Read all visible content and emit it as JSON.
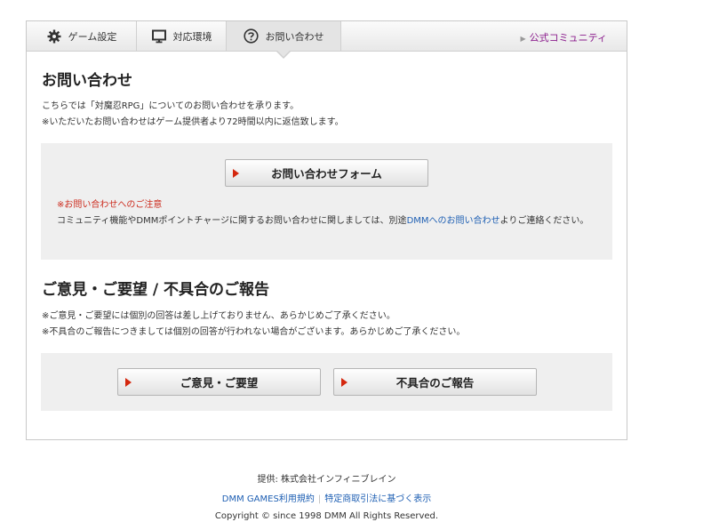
{
  "tabs": [
    {
      "label": "ゲーム設定",
      "icon": "gear-icon"
    },
    {
      "label": "対応環境",
      "icon": "monitor-icon"
    },
    {
      "label": "お問い合わせ",
      "icon": "question-circle-icon"
    }
  ],
  "community_link": "公式コミュニティ",
  "inquiry": {
    "heading": "お問い合わせ",
    "line1": "こちらでは「対魔忍RPG」についてのお問い合わせを承ります。",
    "line2": "※いただいたお問い合わせはゲーム提供者より72時間以内に返信致します。",
    "form_button": "お問い合わせフォーム",
    "notice_title": "※お問い合わせへのご注意",
    "notice_before": "コミュニティ機能やDMMポイントチャージに関するお問い合わせに関しましては、別途",
    "notice_link": "DMMへのお問い合わせ",
    "notice_after": "よりご連絡ください。"
  },
  "feedback": {
    "heading": "ご意見・ご要望 / 不具合のご報告",
    "line1": "※ご意見・ご要望には個別の回答は差し上げておりません、あらかじめご了承ください。",
    "line2": "※不具合のご報告につきましては個別の回答が行われない場合がございます。あらかじめご了承ください。",
    "opinion_button": "ご意見・ご要望",
    "bug_button": "不具合のご報告"
  },
  "footer": {
    "provider": "提供: 株式会社インフィニブレイン",
    "terms_link": "DMM GAMES利用規約",
    "separator": "|",
    "law_link": "特定商取引法に基づく表示",
    "copyright": "Copyright © since 1998 DMM All Rights Reserved."
  },
  "colors": {
    "accent_triangle": "#d4270e",
    "link": "#1e5fb3",
    "community": "#8a1b8c",
    "notice": "#cc2b1d"
  }
}
